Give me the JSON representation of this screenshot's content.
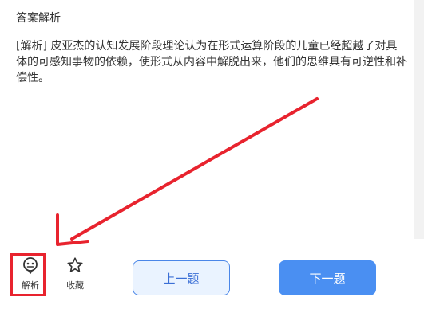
{
  "header": {
    "title": "答案解析"
  },
  "analysis": {
    "text": "[解析] 皮亚杰的认知发展阶段理论认为在形式运算阶段的儿童已经超越了对具体的可感知事物的依赖，使形式从内容中解脱出来，他们的思维具有可逆性和补偿性。"
  },
  "toolbar": {
    "analysis_label": "解析",
    "favorite_label": "收藏",
    "prev_label": "上一题",
    "next_label": "下一题"
  },
  "colors": {
    "annotation_red": "#e8232e",
    "primary_blue": "#4a8ff2",
    "prev_border": "#4a86e8"
  },
  "icons": {
    "analysis": "robot-face-icon",
    "favorite": "star-outline-icon"
  }
}
